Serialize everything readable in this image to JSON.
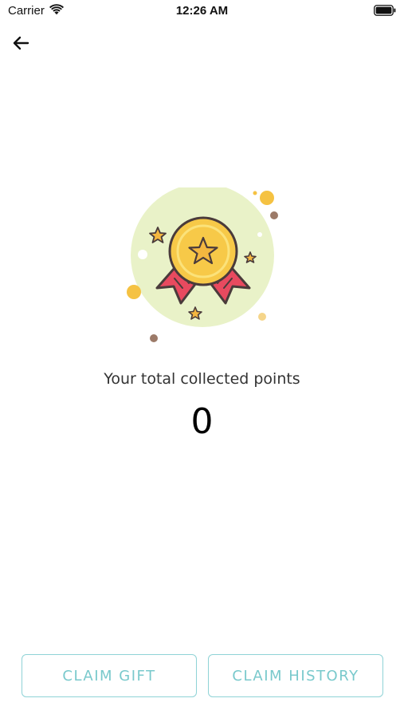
{
  "status_bar": {
    "carrier": "Carrier",
    "time": "12:26 AM",
    "wifi_icon": "wifi-icon",
    "battery_icon": "battery-icon"
  },
  "nav": {
    "back_icon": "arrow-left-icon"
  },
  "illustration": {
    "icon": "medal-icon",
    "colors": {
      "backdrop": "#e9f2c8",
      "medal": "#f7c948",
      "ribbon": "#e84a5f",
      "outline": "#4a3b3b",
      "dot_yellow": "#f5c242",
      "dot_brown": "#9c7a68"
    }
  },
  "points": {
    "label": "Your total collected points",
    "value": "0"
  },
  "actions": {
    "claim_gift": "CLAIM GIFT",
    "claim_history": "CLAIM HISTORY",
    "accent_color": "#79c9cc"
  }
}
